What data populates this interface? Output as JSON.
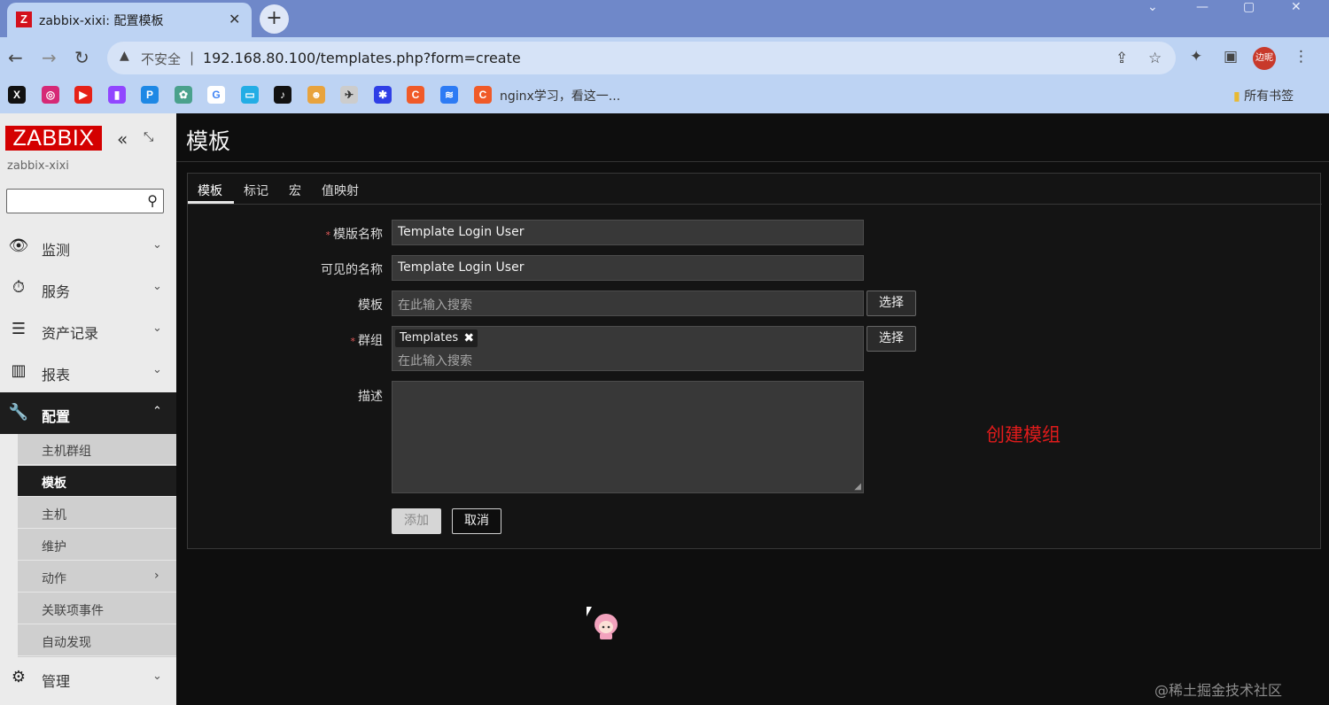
{
  "browser": {
    "tab_title": "zabbix-xixi: 配置模板",
    "favicon": "Z",
    "insecure_label": "不安全",
    "url": "192.168.80.100/templates.php?form=create",
    "profile_label": "边昵",
    "bookmark_text": "nginx学习，看这一...",
    "all_bookmarks": "所有书签"
  },
  "sidebar": {
    "logo": "ZABBIX",
    "server_name": "zabbix-xixi",
    "menu": [
      {
        "label": "监测"
      },
      {
        "label": "服务"
      },
      {
        "label": "资产记录"
      },
      {
        "label": "报表"
      },
      {
        "label": "配置"
      },
      {
        "label": "管理"
      }
    ],
    "submenu": [
      {
        "label": "主机群组"
      },
      {
        "label": "模板"
      },
      {
        "label": "主机"
      },
      {
        "label": "维护"
      },
      {
        "label": "动作"
      },
      {
        "label": "关联项事件"
      },
      {
        "label": "自动发现"
      }
    ]
  },
  "main": {
    "title": "模板",
    "tabs": [
      {
        "label": "模板"
      },
      {
        "label": "标记"
      },
      {
        "label": "宏"
      },
      {
        "label": "值映射"
      }
    ],
    "form": {
      "template_name_label": "模版名称",
      "template_name_value": "Template Login User",
      "visible_name_label": "可见的名称",
      "visible_name_value": "Template Login User",
      "templates_label": "模板",
      "templates_placeholder": "在此输入搜索",
      "groups_label": "群组",
      "group_chip": "Templates",
      "groups_placeholder": "在此输入搜索",
      "description_label": "描述",
      "select_label": "选择",
      "add_label": "添加",
      "cancel_label": "取消"
    },
    "annotation": "创建模组",
    "watermark": "@稀土掘金技术社区"
  }
}
